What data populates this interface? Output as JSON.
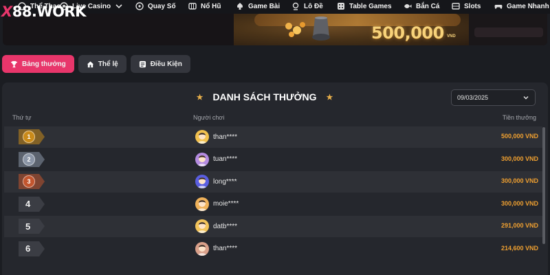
{
  "nav": {
    "items": [
      {
        "label": "Thể Thao",
        "icon": "sports-icon"
      },
      {
        "label": "Live Casino",
        "icon": "casino-chip-icon",
        "has_dropdown": true
      },
      {
        "label": "Quay Số",
        "icon": "lottery-ball-icon"
      },
      {
        "label": "Nổ Hũ",
        "icon": "jackpot-icon"
      },
      {
        "label": "Game Bài",
        "icon": "card-game-icon"
      },
      {
        "label": "Lô Đề",
        "icon": "lotto-icon"
      },
      {
        "label": "Table Games",
        "icon": "dice-icon"
      },
      {
        "label": "Bắn Cá",
        "icon": "fish-icon"
      },
      {
        "label": "Slots",
        "icon": "slot-machine-icon"
      },
      {
        "label": "Game Nhanh",
        "icon": "controller-icon"
      }
    ]
  },
  "logo": {
    "x": "X",
    "rest": "88.WORK"
  },
  "banner": {
    "amount": "500,000",
    "unit": "VND"
  },
  "tabs": [
    {
      "label": "Bảng thưởng",
      "icon": "trophy-icon",
      "active": true
    },
    {
      "label": "Thể lệ",
      "icon": "house-icon",
      "active": false
    },
    {
      "label": "Điều Kiện",
      "icon": "list-icon",
      "active": false
    }
  ],
  "leaderboard": {
    "title": "DANH SÁCH THƯỞNG",
    "date": "09/03/2025",
    "columns": {
      "rank": "Thứ tự",
      "player": "Người chơi",
      "prize": "Tiền thưởng"
    },
    "rows": [
      {
        "rank": "1",
        "medal": "gold",
        "player": "than****",
        "avatar_color": "#f2c14e",
        "prize": "500,000 VND"
      },
      {
        "rank": "2",
        "medal": "silver",
        "player": "tuan****",
        "avatar_color": "#b48be0",
        "prize": "300,000 VND"
      },
      {
        "rank": "3",
        "medal": "bronze",
        "player": "long****",
        "avatar_color": "#5a5ee0",
        "prize": "300,000 VND"
      },
      {
        "rank": "4",
        "medal": "",
        "player": "moie****",
        "avatar_color": "#f0b25a",
        "prize": "300,000 VND"
      },
      {
        "rank": "5",
        "medal": "",
        "player": "datb****",
        "avatar_color": "#f3c45a",
        "prize": "291,000 VND"
      },
      {
        "rank": "6",
        "medal": "",
        "player": "than****",
        "avatar_color": "#d9a08a",
        "prize": "214,600 VND"
      }
    ]
  },
  "colors": {
    "accent": "#e8366b",
    "prize": "#f0a030",
    "gold": "#c98a1a",
    "silver": "#8b95a6",
    "bronze": "#c2552e"
  }
}
